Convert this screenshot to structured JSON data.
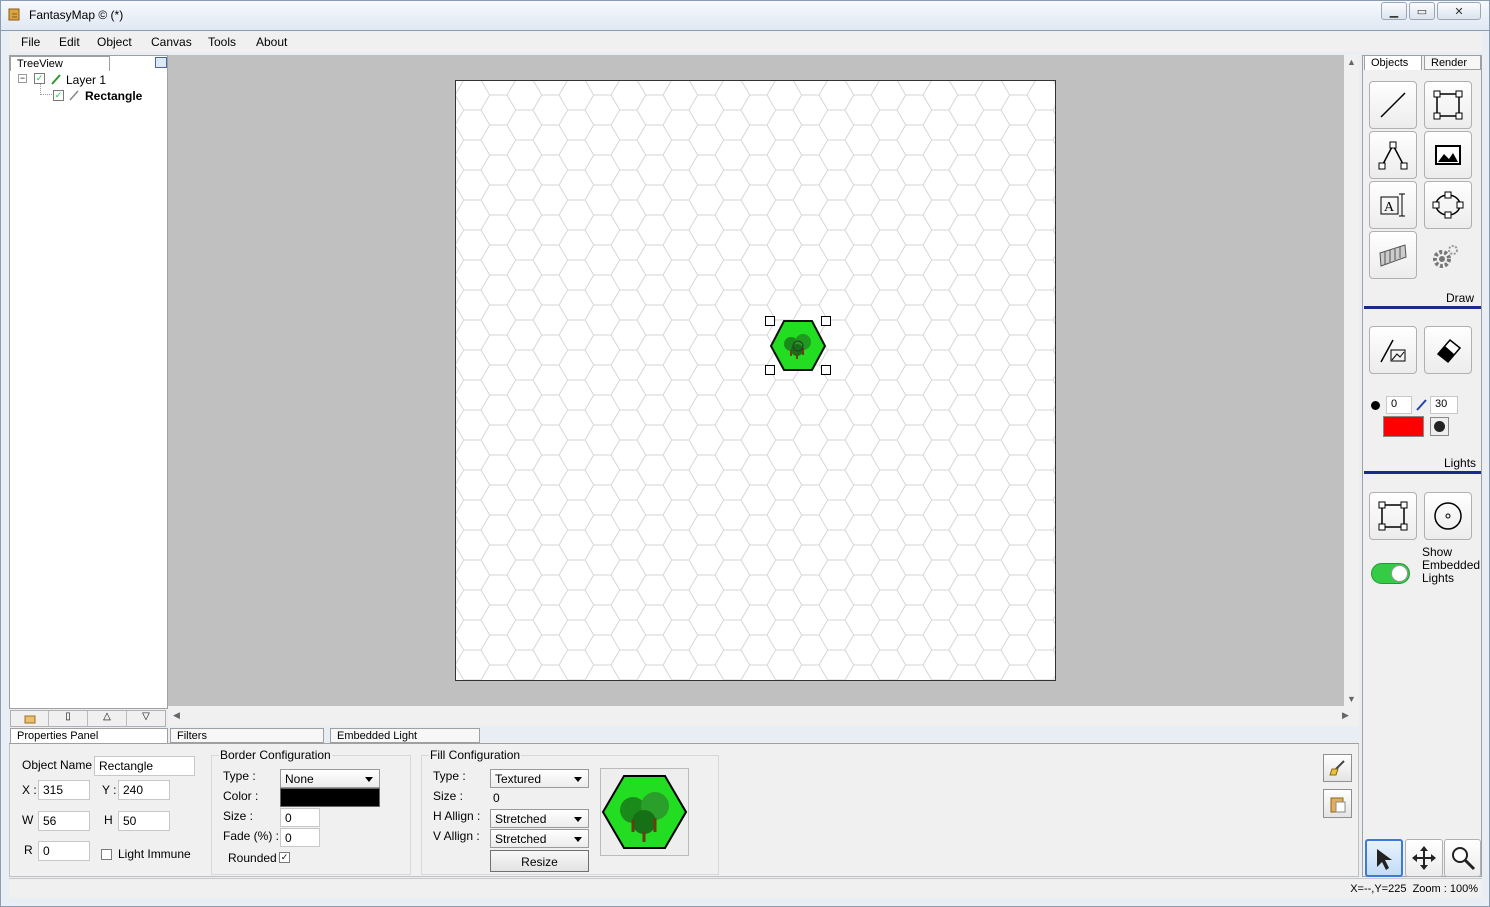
{
  "window": {
    "title": "FantasyMap © (*)"
  },
  "menu": [
    "File",
    "Edit",
    "Object",
    "Canvas",
    "Tools",
    "About"
  ],
  "treeview": {
    "tab_label": "TreeView",
    "items": [
      {
        "label": "Layer 1",
        "checked": true
      },
      {
        "label": "Rectangle",
        "checked": true
      }
    ]
  },
  "bottom_tabs": [
    "Properties Panel",
    "Filters",
    "Embedded Light"
  ],
  "properties": {
    "object_name_label": "Object Name",
    "object_name": "Rectangle",
    "x_label": "X :",
    "x": "315",
    "y_label": "Y :",
    "y": "240",
    "w_label": "W",
    "w": "56",
    "h_label": "H",
    "h": "50",
    "r_label": "R",
    "r": "0",
    "light_immune_label": "Light Immune",
    "light_immune": false
  },
  "border_config": {
    "title": "Border Configuration",
    "type_label": "Type :",
    "type": "None",
    "color_label": "Color :",
    "color": "#000000",
    "size_label": "Size :",
    "size": "0",
    "fade_label": "Fade (%) :",
    "fade": "0",
    "rounded_label": "Rounded",
    "rounded": true
  },
  "fill_config": {
    "title": "Fill Configuration",
    "type_label": "Type :",
    "type": "Textured",
    "size_label": "Size :",
    "size": "0",
    "halign_label": "H Allign :",
    "halign": "Stretched",
    "valign_label": "V Allign :",
    "valign": "Stretched",
    "resize_label": "Resize"
  },
  "right_tabs": [
    "Objects",
    "Render"
  ],
  "draw_label": "Draw",
  "lights_label": "Lights",
  "brush": {
    "size": "0",
    "opacity": "30",
    "color": "#ff0000"
  },
  "show_embedded_lights": {
    "label_lines": [
      "Show",
      "Embedded",
      "Lights"
    ],
    "on": true
  },
  "status": "X=--,Y=225  Zoom : 100%",
  "colors": {
    "accent_line": "#1a2b8c",
    "hex_fill": "#22dd22",
    "toggle": "#33cc44"
  }
}
